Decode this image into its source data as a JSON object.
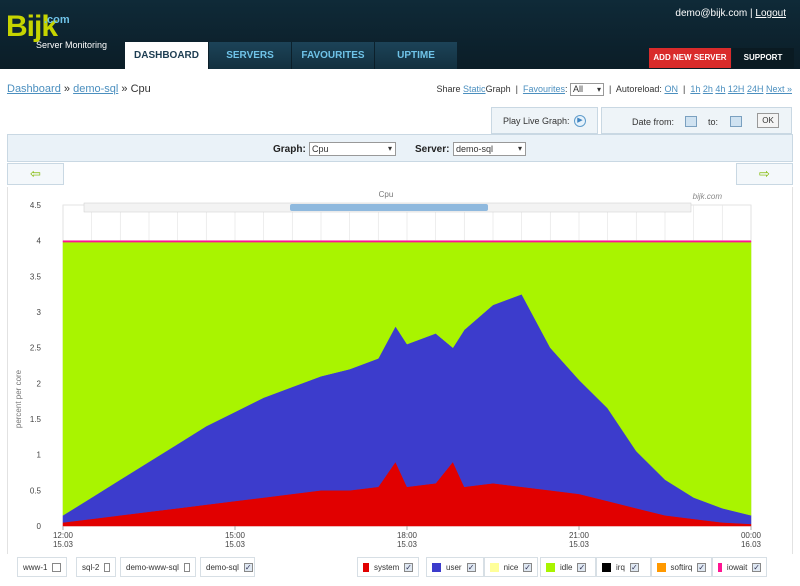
{
  "header": {
    "logo_text": "Bijk",
    "logo_tld": ".com",
    "logo_sub": "Server Monitoring",
    "user_email": "demo@bijk.com",
    "separator": "|",
    "logout_label": "Logout",
    "nav_tabs": [
      "DASHBOARD",
      "SERVERS",
      "FAVOURITES",
      "UPTIME"
    ],
    "add_server_label": "ADD NEW SERVER",
    "support_label": "SUPPORT"
  },
  "breadcrumb": {
    "dashboard": "Dashboard",
    "sep1": "»",
    "server": "demo-sql",
    "sep2": "»",
    "current": "Cpu"
  },
  "toolbar": {
    "share_prefix": "Share",
    "share_link": "Static",
    "share_suffix": "Graph",
    "favourites_label": "Favourites",
    "favourites_colon": ":",
    "favourites_value": "All",
    "autoreload_label": "Autoreload:",
    "autoreload_value": "ON",
    "ranges": [
      "1h",
      "2h",
      "4h",
      "12H",
      "24H"
    ],
    "next_label": "Next »"
  },
  "play": {
    "label": "Play Live Graph:",
    "icon": "play-icon"
  },
  "date": {
    "from_label": "Date from:",
    "to_label": "to:",
    "ok_label": "OK"
  },
  "selector": {
    "graph_label": "Graph:",
    "graph_value": "Cpu",
    "server_label": "Server:",
    "server_value": "demo-sql"
  },
  "nav_arrows": {
    "prev_icon": "arrow-left-icon",
    "next_icon": "arrow-right-icon",
    "prev_glyph": "⇦",
    "next_glyph": "⇨"
  },
  "chart_data": {
    "type": "area",
    "title": "Cpu",
    "watermark": "bijk.com",
    "ylabel": "percent per core",
    "xlabel": "",
    "ylim": [
      0,
      4.5
    ],
    "y_ticks": [
      "0",
      "0.5",
      "1",
      "1.5",
      "2",
      "2.5",
      "3",
      "3.5",
      "4",
      "4.5"
    ],
    "x_range_hours": [
      12.0,
      24.0
    ],
    "x_ticks": [
      {
        "hour": 12,
        "time": "12:00",
        "date": "15.03"
      },
      {
        "hour": 15,
        "time": "15:00",
        "date": "15.03"
      },
      {
        "hour": 18,
        "time": "18:00",
        "date": "15.03"
      },
      {
        "hour": 21,
        "time": "21:00",
        "date": "15.03"
      },
      {
        "hour": 24,
        "time": "00:00",
        "date": "16.03"
      }
    ],
    "grid": true,
    "stacked": true,
    "x": [
      12.0,
      12.5,
      13.0,
      13.5,
      14.0,
      14.5,
      15.0,
      15.5,
      16.0,
      16.5,
      17.0,
      17.5,
      17.8,
      18.0,
      18.5,
      18.8,
      19.0,
      19.5,
      20.0,
      20.5,
      21.0,
      21.5,
      22.0,
      22.5,
      23.0,
      23.5,
      24.0
    ],
    "series": [
      {
        "name": "system",
        "color": "#e10000",
        "values": [
          0.05,
          0.1,
          0.15,
          0.2,
          0.25,
          0.3,
          0.35,
          0.4,
          0.45,
          0.5,
          0.5,
          0.55,
          0.9,
          0.55,
          0.6,
          0.9,
          0.55,
          0.6,
          0.55,
          0.5,
          0.45,
          0.35,
          0.25,
          0.15,
          0.1,
          0.05,
          0.03
        ]
      },
      {
        "name": "user",
        "color": "#3c3ccc",
        "values": [
          0.1,
          0.3,
          0.5,
          0.7,
          0.9,
          1.1,
          1.25,
          1.4,
          1.5,
          1.6,
          1.7,
          1.8,
          1.9,
          2.0,
          2.1,
          1.6,
          2.2,
          2.5,
          2.7,
          2.0,
          1.6,
          1.3,
          0.8,
          0.5,
          0.3,
          0.2,
          0.12
        ]
      },
      {
        "name": "nice",
        "color": "#ffff99",
        "values": [
          0,
          0,
          0,
          0,
          0,
          0,
          0,
          0,
          0,
          0,
          0,
          0,
          0,
          0,
          0,
          0,
          0,
          0,
          0,
          0,
          0,
          0,
          0,
          0,
          0,
          0,
          0
        ]
      },
      {
        "name": "idle",
        "color": "#a9f400",
        "values": [
          3.83,
          3.58,
          3.33,
          3.08,
          2.83,
          2.58,
          2.38,
          2.18,
          2.03,
          1.88,
          1.78,
          1.63,
          1.18,
          1.43,
          1.28,
          1.48,
          1.23,
          0.88,
          0.73,
          1.48,
          1.93,
          2.33,
          2.93,
          3.33,
          3.58,
          3.73,
          3.83
        ]
      },
      {
        "name": "irq",
        "color": "#000000",
        "values": [
          0,
          0,
          0,
          0,
          0,
          0,
          0,
          0,
          0,
          0,
          0,
          0,
          0,
          0,
          0,
          0,
          0,
          0,
          0,
          0,
          0,
          0,
          0,
          0,
          0,
          0,
          0
        ]
      },
      {
        "name": "softirq",
        "color": "#ff9900",
        "values": [
          0,
          0,
          0,
          0,
          0,
          0,
          0,
          0,
          0,
          0,
          0,
          0,
          0,
          0,
          0,
          0,
          0,
          0,
          0,
          0,
          0,
          0,
          0,
          0,
          0,
          0,
          0
        ]
      },
      {
        "name": "iowait",
        "color": "#ff1493",
        "values": [
          0.02,
          0.02,
          0.02,
          0.02,
          0.02,
          0.02,
          0.02,
          0.02,
          0.02,
          0.02,
          0.02,
          0.02,
          0.02,
          0.02,
          0.02,
          0.02,
          0.02,
          0.02,
          0.02,
          0.02,
          0.02,
          0.02,
          0.02,
          0.02,
          0.02,
          0.02,
          0.02
        ]
      }
    ]
  },
  "legend": {
    "servers": [
      {
        "name": "www-1",
        "checked": false
      },
      {
        "name": "sql-2",
        "checked": false
      },
      {
        "name": "demo-www-sql",
        "checked": false
      },
      {
        "name": "demo-sql",
        "checked": true
      }
    ],
    "series": [
      {
        "name": "system",
        "color": "#e10000"
      },
      {
        "name": "user",
        "color": "#3c3ccc"
      },
      {
        "name": "nice",
        "color": "#ffff99"
      },
      {
        "name": "idle",
        "color": "#a9f400"
      },
      {
        "name": "irq",
        "color": "#000000"
      },
      {
        "name": "softirq",
        "color": "#ff9900"
      },
      {
        "name": "iowait",
        "color": "#ff1493"
      }
    ],
    "check_glyph": "✓"
  }
}
